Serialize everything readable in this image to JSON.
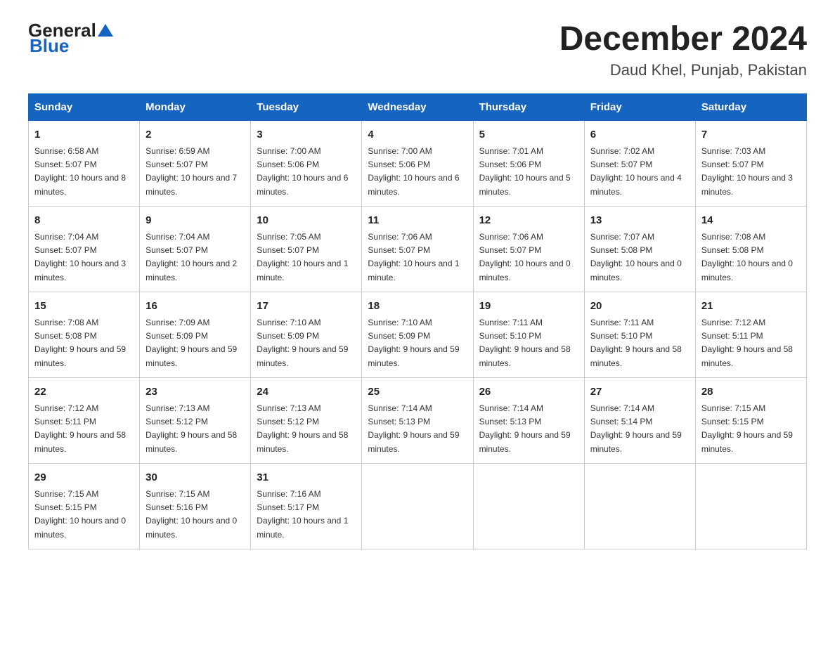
{
  "header": {
    "logo_general": "General",
    "logo_blue": "Blue",
    "month": "December 2024",
    "location": "Daud Khel, Punjab, Pakistan"
  },
  "columns": [
    "Sunday",
    "Monday",
    "Tuesday",
    "Wednesday",
    "Thursday",
    "Friday",
    "Saturday"
  ],
  "weeks": [
    [
      {
        "day": "1",
        "sunrise": "6:58 AM",
        "sunset": "5:07 PM",
        "daylight": "10 hours and 8 minutes."
      },
      {
        "day": "2",
        "sunrise": "6:59 AM",
        "sunset": "5:07 PM",
        "daylight": "10 hours and 7 minutes."
      },
      {
        "day": "3",
        "sunrise": "7:00 AM",
        "sunset": "5:06 PM",
        "daylight": "10 hours and 6 minutes."
      },
      {
        "day": "4",
        "sunrise": "7:00 AM",
        "sunset": "5:06 PM",
        "daylight": "10 hours and 6 minutes."
      },
      {
        "day": "5",
        "sunrise": "7:01 AM",
        "sunset": "5:06 PM",
        "daylight": "10 hours and 5 minutes."
      },
      {
        "day": "6",
        "sunrise": "7:02 AM",
        "sunset": "5:07 PM",
        "daylight": "10 hours and 4 minutes."
      },
      {
        "day": "7",
        "sunrise": "7:03 AM",
        "sunset": "5:07 PM",
        "daylight": "10 hours and 3 minutes."
      }
    ],
    [
      {
        "day": "8",
        "sunrise": "7:04 AM",
        "sunset": "5:07 PM",
        "daylight": "10 hours and 3 minutes."
      },
      {
        "day": "9",
        "sunrise": "7:04 AM",
        "sunset": "5:07 PM",
        "daylight": "10 hours and 2 minutes."
      },
      {
        "day": "10",
        "sunrise": "7:05 AM",
        "sunset": "5:07 PM",
        "daylight": "10 hours and 1 minute."
      },
      {
        "day": "11",
        "sunrise": "7:06 AM",
        "sunset": "5:07 PM",
        "daylight": "10 hours and 1 minute."
      },
      {
        "day": "12",
        "sunrise": "7:06 AM",
        "sunset": "5:07 PM",
        "daylight": "10 hours and 0 minutes."
      },
      {
        "day": "13",
        "sunrise": "7:07 AM",
        "sunset": "5:08 PM",
        "daylight": "10 hours and 0 minutes."
      },
      {
        "day": "14",
        "sunrise": "7:08 AM",
        "sunset": "5:08 PM",
        "daylight": "10 hours and 0 minutes."
      }
    ],
    [
      {
        "day": "15",
        "sunrise": "7:08 AM",
        "sunset": "5:08 PM",
        "daylight": "9 hours and 59 minutes."
      },
      {
        "day": "16",
        "sunrise": "7:09 AM",
        "sunset": "5:09 PM",
        "daylight": "9 hours and 59 minutes."
      },
      {
        "day": "17",
        "sunrise": "7:10 AM",
        "sunset": "5:09 PM",
        "daylight": "9 hours and 59 minutes."
      },
      {
        "day": "18",
        "sunrise": "7:10 AM",
        "sunset": "5:09 PM",
        "daylight": "9 hours and 59 minutes."
      },
      {
        "day": "19",
        "sunrise": "7:11 AM",
        "sunset": "5:10 PM",
        "daylight": "9 hours and 58 minutes."
      },
      {
        "day": "20",
        "sunrise": "7:11 AM",
        "sunset": "5:10 PM",
        "daylight": "9 hours and 58 minutes."
      },
      {
        "day": "21",
        "sunrise": "7:12 AM",
        "sunset": "5:11 PM",
        "daylight": "9 hours and 58 minutes."
      }
    ],
    [
      {
        "day": "22",
        "sunrise": "7:12 AM",
        "sunset": "5:11 PM",
        "daylight": "9 hours and 58 minutes."
      },
      {
        "day": "23",
        "sunrise": "7:13 AM",
        "sunset": "5:12 PM",
        "daylight": "9 hours and 58 minutes."
      },
      {
        "day": "24",
        "sunrise": "7:13 AM",
        "sunset": "5:12 PM",
        "daylight": "9 hours and 58 minutes."
      },
      {
        "day": "25",
        "sunrise": "7:14 AM",
        "sunset": "5:13 PM",
        "daylight": "9 hours and 59 minutes."
      },
      {
        "day": "26",
        "sunrise": "7:14 AM",
        "sunset": "5:13 PM",
        "daylight": "9 hours and 59 minutes."
      },
      {
        "day": "27",
        "sunrise": "7:14 AM",
        "sunset": "5:14 PM",
        "daylight": "9 hours and 59 minutes."
      },
      {
        "day": "28",
        "sunrise": "7:15 AM",
        "sunset": "5:15 PM",
        "daylight": "9 hours and 59 minutes."
      }
    ],
    [
      {
        "day": "29",
        "sunrise": "7:15 AM",
        "sunset": "5:15 PM",
        "daylight": "10 hours and 0 minutes."
      },
      {
        "day": "30",
        "sunrise": "7:15 AM",
        "sunset": "5:16 PM",
        "daylight": "10 hours and 0 minutes."
      },
      {
        "day": "31",
        "sunrise": "7:16 AM",
        "sunset": "5:17 PM",
        "daylight": "10 hours and 1 minute."
      },
      null,
      null,
      null,
      null
    ]
  ]
}
